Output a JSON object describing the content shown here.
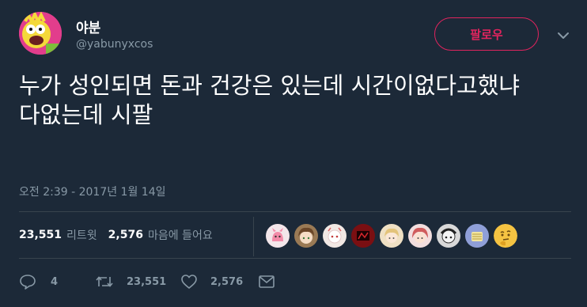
{
  "user": {
    "name": "야분",
    "handle": "@yabunyxcos",
    "avatar_icon": "cartoon-character-avatar"
  },
  "follow_button": {
    "label": "팔로우"
  },
  "menu_icon": "chevron-down-icon",
  "tweet": {
    "text": "누가 성인되면 돈과 건강은 있는데 시간이없다고했냐\n다없는데 시팔",
    "timestamp": "오전 2:39 - 2017년 1월 14일"
  },
  "stats": {
    "retweets_count": "23,551",
    "retweets_label": "리트윗",
    "likes_count": "2,576",
    "likes_label": "마음에 들어요"
  },
  "likers": [
    {
      "icon": "pink-creature-avatar",
      "bg": "#f3e6ea"
    },
    {
      "icon": "anime-girl-brown-hair-avatar",
      "bg": "#9a7a55"
    },
    {
      "icon": "white-anime-avatar",
      "bg": "#f1e8e4"
    },
    {
      "icon": "red-dark-art-avatar",
      "bg": "#7a0f12"
    },
    {
      "icon": "blonde-anime-avatar",
      "bg": "#efe0c4"
    },
    {
      "icon": "red-hair-anime-avatar",
      "bg": "#d05c5c"
    },
    {
      "icon": "manga-sketch-avatar",
      "bg": "#6d6d6d"
    },
    {
      "icon": "blue-illustration-avatar",
      "bg": "#8f9fd8"
    },
    {
      "icon": "thinking-face-emoji-avatar",
      "bg": "#f5c342"
    }
  ],
  "actions": {
    "reply_count": "4",
    "retweet_count": "23,551",
    "like_count": "2,576"
  },
  "colors": {
    "background": "#1c2938",
    "accent": "#e0245e",
    "muted": "#8899a6",
    "divider": "#38444d"
  }
}
